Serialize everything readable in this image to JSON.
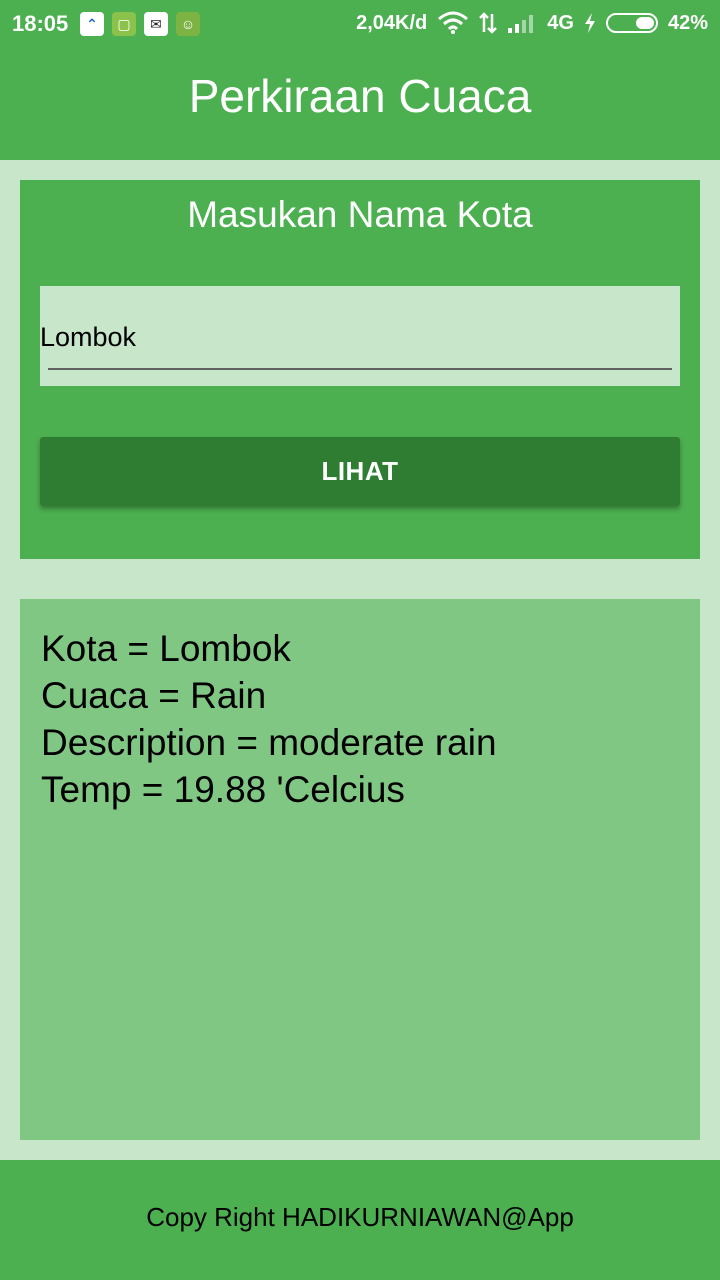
{
  "status_bar": {
    "time": "18:05",
    "network_speed": "2,04K/d",
    "network_type": "4G",
    "battery_percent": "42%",
    "battery_level": 0.42,
    "notification_icons": [
      "arrow-up-icon",
      "sim-card-icon",
      "chat-icon",
      "android-icon"
    ]
  },
  "app_bar": {
    "title": "Perkiraan Cuaca"
  },
  "input_card": {
    "heading": "Masukan Nama Kota",
    "city_value": "Lombok",
    "button_label": "LIHAT"
  },
  "result": {
    "lines": [
      "Kota = Lombok",
      "Cuaca = Rain",
      "Description = moderate rain",
      "Temp = 19.88 'Celcius"
    ]
  },
  "footer": {
    "text": "Copy Right HADIKURNIAWAN@App"
  },
  "colors": {
    "primary": "#4caf50",
    "primary_dark": "#2e7d32",
    "background": "#c8e6c9",
    "result_panel": "#81c784"
  }
}
